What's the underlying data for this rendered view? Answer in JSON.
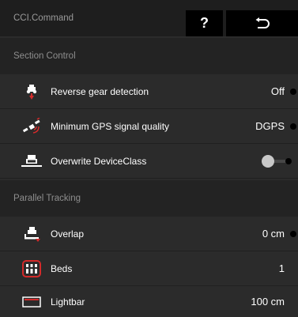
{
  "header": {
    "app_title": "CCI.Command",
    "help_label": "?",
    "back_icon": "back-arrow-icon"
  },
  "sections": [
    {
      "title": "Section Control",
      "rows": [
        {
          "icon": "reverse-gear-icon",
          "label": "Reverse gear detection",
          "value": "Off"
        },
        {
          "icon": "gps-satellite-icon",
          "label": "Minimum GPS signal quality",
          "value": "DGPS"
        },
        {
          "icon": "device-class-icon",
          "label": "Overwrite DeviceClass",
          "toggle": "off"
        }
      ]
    },
    {
      "title": "Parallel Tracking",
      "rows": [
        {
          "icon": "overlap-icon",
          "label": "Overlap",
          "value": "0 cm"
        },
        {
          "icon": "beds-icon",
          "label": "Beds",
          "value": "1"
        },
        {
          "icon": "lightbar-icon",
          "label": "Lightbar",
          "value": "100 cm"
        }
      ]
    }
  ],
  "colors": {
    "accent_red": "#d42a2a",
    "background": "#2b2b2b",
    "header_bg": "#1e1e1e",
    "button_bg": "#000000"
  }
}
